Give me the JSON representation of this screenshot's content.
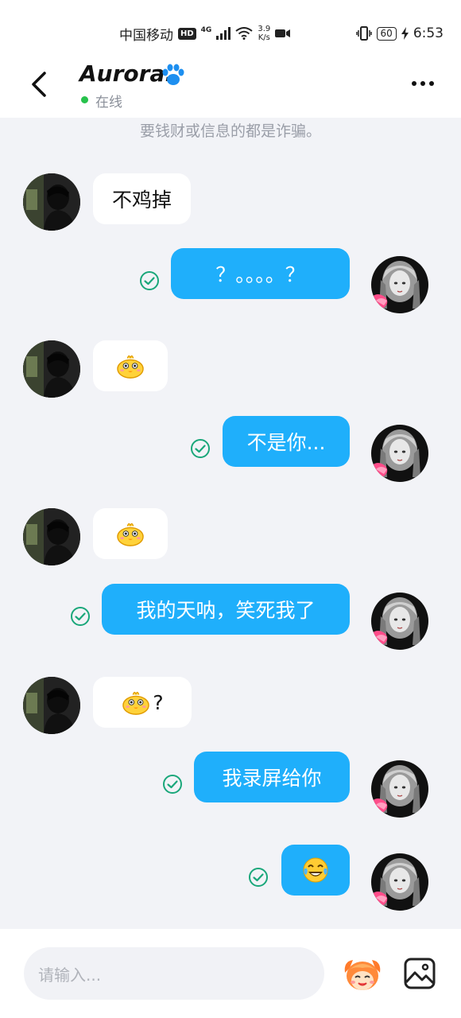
{
  "status_bar": {
    "carrier": "中国移动",
    "hd": "HD",
    "network": "4G",
    "speed_value": "3.9",
    "speed_unit": "K/s",
    "battery": "60",
    "time": "6:53"
  },
  "header": {
    "contact_name": "Aurora.",
    "status": "在线"
  },
  "notice": "要钱财或信息的都是诈骗。",
  "messages": [
    {
      "side": "in",
      "text": "不鸡掉"
    },
    {
      "side": "out",
      "text": "？。。。。？",
      "read": true
    },
    {
      "side": "in",
      "text": "",
      "sticker": "yellow-bird-emoji"
    },
    {
      "side": "out",
      "text": "不是你...",
      "read": true
    },
    {
      "side": "in",
      "text": "",
      "sticker": "yellow-bird-emoji"
    },
    {
      "side": "out",
      "text": "我的天呐，笑死我了",
      "read": true
    },
    {
      "side": "in",
      "text": "?",
      "sticker": "yellow-bird-emoji"
    },
    {
      "side": "out",
      "text": "我录屏给你",
      "read": true
    },
    {
      "side": "out",
      "text": "",
      "sticker": "tears-of-joy-emoji",
      "read": true
    }
  ],
  "input": {
    "placeholder": "请输入..."
  },
  "colors": {
    "accent": "#1faffb",
    "online": "#27c24c",
    "read_check": "#1aa77a",
    "chat_bg": "#f2f3f7"
  }
}
